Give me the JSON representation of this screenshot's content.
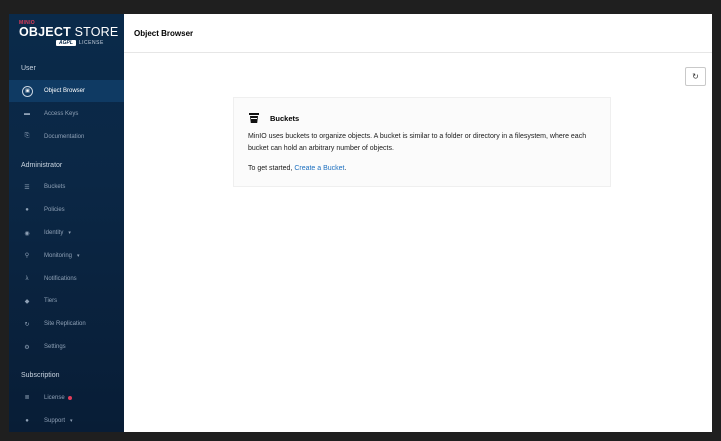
{
  "brand": {
    "small": "MINIO",
    "main_bold": "OBJECT",
    "main_thin": " STORE",
    "badge": "AGPL",
    "license": "LICENSE"
  },
  "sidebar": {
    "sections": {
      "user": "User",
      "administrator": "Administrator",
      "subscription": "Subscription"
    },
    "items": {
      "object_browser": "Object Browser",
      "access_keys": "Access Keys",
      "documentation": "Documentation",
      "buckets": "Buckets",
      "policies": "Policies",
      "identity": "Identity",
      "monitoring": "Monitoring",
      "notifications": "Notifications",
      "tiers": "Tiers",
      "site_replication": "Site Replication",
      "settings": "Settings",
      "license": "License",
      "support": "Support"
    }
  },
  "header": {
    "title": "Object Browser"
  },
  "card": {
    "title": "Buckets",
    "text": "MinIO uses buckets to organize objects. A bucket is similar to a folder or directory in a filesystem, where each bucket can hold an arbitrary number of objects.",
    "cta_prefix": "To get started, ",
    "cta_link": "Create a Bucket",
    "cta_suffix": "."
  },
  "colors": {
    "sidebar_bg": "#0a2a4a",
    "active_bg": "#0f3a63",
    "brand_red": "#e23d5a",
    "link": "#1c6fbf"
  }
}
